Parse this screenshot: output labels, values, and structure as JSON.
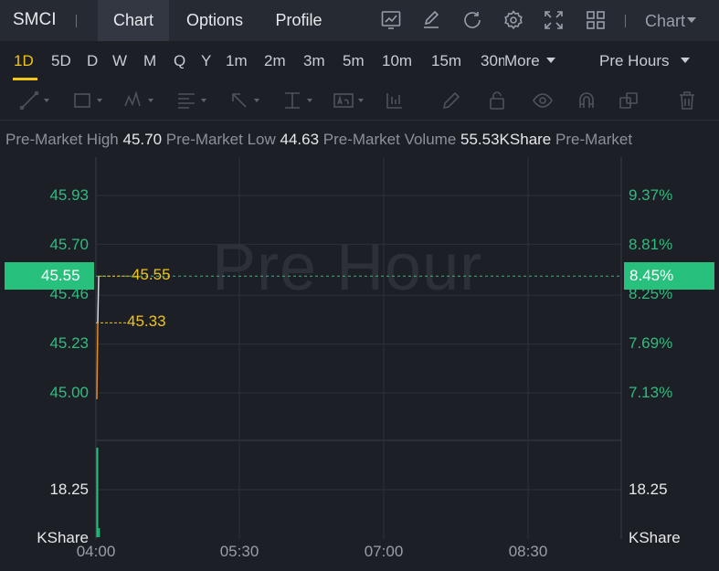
{
  "header": {
    "ticker": "SMCI",
    "tabs": [
      "Chart",
      "Options",
      "Profile"
    ],
    "active_tab": "Chart",
    "icons": [
      "indicator-chart-icon",
      "edit-icon",
      "refresh-icon",
      "settings-icon",
      "fullscreen-icon",
      "grid-layout-icon"
    ],
    "chart_menu": "Chart"
  },
  "timeframes": {
    "items": [
      "1D",
      "5D",
      "D",
      "W",
      "M",
      "Q",
      "Y",
      "1m",
      "2m",
      "3m",
      "5m",
      "10m",
      "15m",
      "30m"
    ],
    "active": "1D",
    "more_label": "More",
    "session_label": "Pre Hours"
  },
  "drawing_tools": [
    "line-tool-icon",
    "rectangle-tool-icon",
    "pattern-tool-icon",
    "fibonacci-tool-icon",
    "arrow-tool-icon",
    "measure-tool-icon",
    "text-tool-icon",
    "bar-pattern-icon",
    "pencil-icon",
    "lock-icon",
    "eye-icon",
    "magnet-icon",
    "layers-icon",
    "trash-icon"
  ],
  "stats": {
    "high_label": "Pre-Market High",
    "high_value": "45.70",
    "low_label": "Pre-Market Low",
    "low_value": "44.63",
    "volume_label": "Pre-Market Volume",
    "volume_value": "55.53KShare",
    "trailing_label": "Pre-Market"
  },
  "chart": {
    "watermark": "Pre Hour",
    "current_price": "45.55",
    "current_pct": "8.45%",
    "price_line_label": "45.55",
    "low_line_label": "45.33",
    "volume_left_label": "18.25",
    "volume_right_label": "18.25",
    "volume_unit_left": "KShare",
    "volume_unit_right": "KShare",
    "colors": {
      "up": "#27c07d",
      "highlight": "#f0c419",
      "bg": "#1c1f26"
    }
  },
  "chart_data": {
    "type": "line",
    "y_ticks_left": [
      "45.93",
      "45.70",
      "45.46",
      "45.23",
      "45.00"
    ],
    "y_ticks_right": [
      "9.37%",
      "8.81%",
      "8.25%",
      "7.69%",
      "7.13%"
    ],
    "x_ticks": [
      "04:00",
      "05:30",
      "07:00",
      "08:30"
    ],
    "price_series": {
      "x": [
        "04:00",
        "04:00",
        "04:00"
      ],
      "y": [
        44.97,
        45.33,
        45.55
      ]
    },
    "volume": {
      "y": [
        18.25,
        18.25
      ],
      "bars": [
        [
          "04:00",
          40.0
        ],
        [
          "04:00",
          5.0
        ]
      ]
    },
    "ylim": [
      44.85,
      46.05
    ],
    "grid": true
  }
}
